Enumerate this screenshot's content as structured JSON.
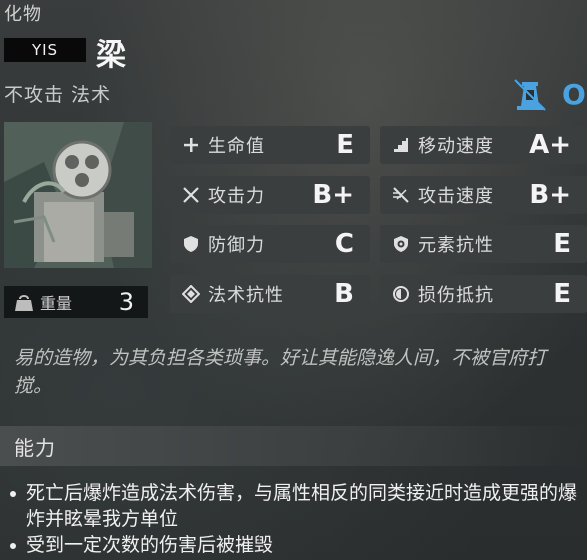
{
  "header": {
    "category": "化物",
    "code_tag": "YIS",
    "name": "梁",
    "traits": "不攻击 法术",
    "rank_text": "O"
  },
  "weight": {
    "label": "重量",
    "value": "3"
  },
  "stats": [
    {
      "label": "生命值",
      "grade": "E",
      "icon": "plus-icon"
    },
    {
      "label": "移动速度",
      "grade": "A+",
      "icon": "stairs-icon"
    },
    {
      "label": "攻击力",
      "grade": "B+",
      "icon": "crossed-swords-icon"
    },
    {
      "label": "攻击速度",
      "grade": "B+",
      "icon": "speed-swords-icon"
    },
    {
      "label": "防御力",
      "grade": "C",
      "icon": "shield-icon"
    },
    {
      "label": "元素抗性",
      "grade": "E",
      "icon": "element-shield-icon"
    },
    {
      "label": "法术抗性",
      "grade": "B",
      "icon": "diamond-icon"
    },
    {
      "label": "损伤抵抗",
      "grade": "E",
      "icon": "ring-icon"
    }
  ],
  "description": "易的造物，为其负担各类琐事。好让其能隐逸人间，不被官府打搅。",
  "abilities": {
    "title": "能力",
    "items": [
      "死亡后爆炸造成法术伤害，与属性相反的同类接近时造成更强的爆炸并眩晕我方单位",
      "受到一定次数的伤害后被摧毁"
    ]
  },
  "colors": {
    "rank_blue": "#4aa3e0",
    "panel": "#3a3e3f"
  }
}
